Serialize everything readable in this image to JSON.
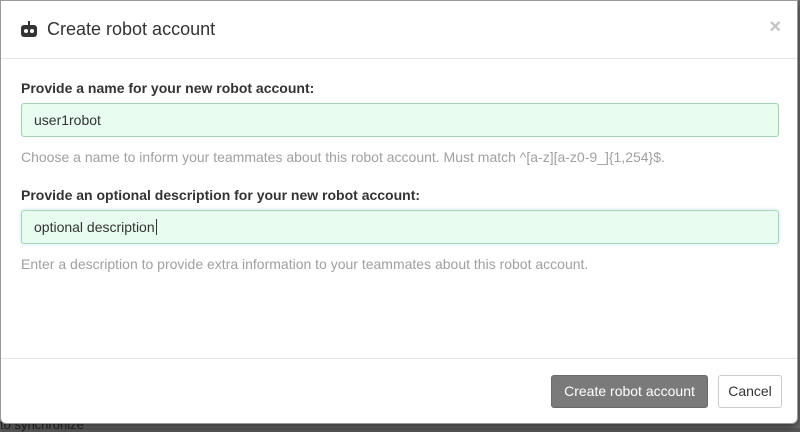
{
  "backdrop": {
    "partial_text": "to synchronize"
  },
  "modal": {
    "title": "Create robot account",
    "close_label": "×",
    "name_field": {
      "label": "Provide a name for your new robot account:",
      "value": "user1robot",
      "help": "Choose a name to inform your teammates about this robot account. Must match ^[a-z][a-z0-9_]{1,254}$."
    },
    "description_field": {
      "label": "Provide an optional description for your new robot account:",
      "value": "optional description",
      "help": "Enter a description to provide extra information to your teammates about this robot account."
    },
    "footer": {
      "create_label": "Create robot account",
      "cancel_label": "Cancel"
    }
  },
  "colors": {
    "input_bg": "#e8fcef",
    "primary_button": "#7a7a7a"
  },
  "icons": {
    "title_icon": "robot-icon",
    "close_icon": "close-icon"
  }
}
